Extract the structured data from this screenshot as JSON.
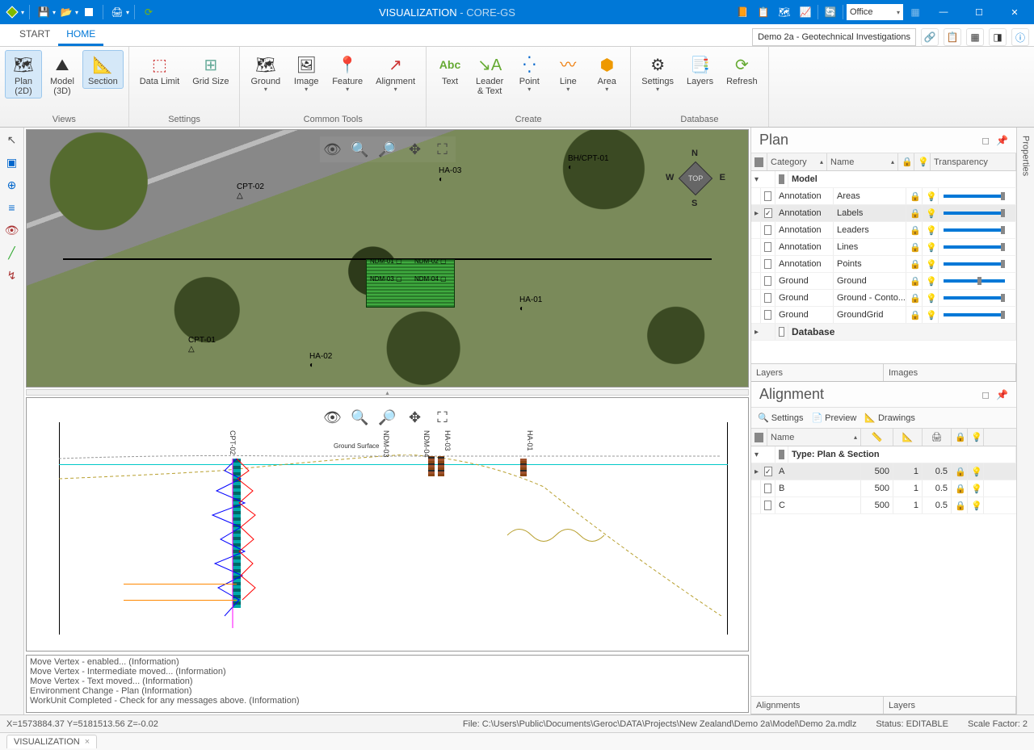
{
  "title": {
    "app": "VISUALIZATION",
    "suffix": " - CORE-GS"
  },
  "office": "Office",
  "tabs": {
    "start": "START",
    "home": "HOME"
  },
  "docselect": "Demo 2a - Geotechnical Investigations",
  "ribbon": {
    "groups": {
      "views": "Views",
      "settings": "Settings",
      "common": "Common Tools",
      "create": "Create",
      "database": "Database"
    },
    "btns": {
      "plan2d": "Plan\n(2D)",
      "model3d": "Model\n(3D)",
      "section": "Section",
      "datalimit": "Data Limit",
      "gridsize": "Grid Size",
      "ground": "Ground",
      "image": "Image",
      "feature": "Feature",
      "alignment": "Alignment",
      "text": "Text",
      "abc": "Abc",
      "leader": "Leader\n& Text",
      "point": "Point",
      "line": "Line",
      "area": "Area",
      "dbsettings": "Settings",
      "layers": "Layers",
      "refresh": "Refresh"
    }
  },
  "mapLabels": {
    "cpt01": "CPT-01",
    "cpt02": "CPT-02",
    "ha01": "HA-01",
    "ha02": "HA-02",
    "ha03": "HA-03",
    "bhcpt01": "BH/CPT-01",
    "ndm01": "NDM-01",
    "ndm02": "NDM-02",
    "ndm03": "NDM-03",
    "ndm04": "NDM-04"
  },
  "compass": {
    "n": "N",
    "e": "E",
    "s": "S",
    "w": "W",
    "top": "TOP"
  },
  "sectLabels": {
    "cpt02": "CPT-02",
    "ndm03": "NDM-03",
    "ndm04": "NDM-04",
    "ha03": "HA-03",
    "ha01": "HA-01",
    "gs": "Ground Surface"
  },
  "log": [
    "Move Vertex - enabled... (Information)",
    "Move Vertex - Intermediate moved... (Information)",
    "Move Vertex - Text moved... (Information)",
    "Environment Change - Plan (Information)",
    "WorkUnit Completed - Check for any messages above. (Information)"
  ],
  "planPanel": {
    "title": "Plan",
    "hdr": {
      "category": "Category",
      "name": "Name",
      "transp": "Transparency"
    },
    "groupModel": "Model",
    "rows": [
      {
        "cat": "Annotation",
        "name": "Areas",
        "bulb": true
      },
      {
        "cat": "Annotation",
        "name": "Labels",
        "bulb": true,
        "sel": true,
        "chk": true,
        "exp": true
      },
      {
        "cat": "Annotation",
        "name": "Leaders",
        "bulb": true
      },
      {
        "cat": "Annotation",
        "name": "Lines",
        "bulb": true
      },
      {
        "cat": "Annotation",
        "name": "Points",
        "bulb": true
      },
      {
        "cat": "Ground",
        "name": "Ground",
        "bulb": false,
        "slider": 0.6
      },
      {
        "cat": "Ground",
        "name": "Ground - Conto...",
        "bulb": false
      },
      {
        "cat": "Ground",
        "name": "GroundGrid",
        "bulb": false
      }
    ],
    "groupDb": "Database",
    "tabs": {
      "layers": "Layers",
      "images": "Images"
    }
  },
  "alignPanel": {
    "title": "Alignment",
    "toolbar": {
      "settings": "Settings",
      "preview": "Preview",
      "drawings": "Drawings"
    },
    "hdr": {
      "name": "Name"
    },
    "group": "Type: Plan & Section",
    "rows": [
      {
        "name": "A",
        "c1": "500",
        "c2": "1",
        "c3": "0.5",
        "chk": true,
        "sel": true,
        "bulb": true,
        "exp": true
      },
      {
        "name": "B",
        "c1": "500",
        "c2": "1",
        "c3": "0.5",
        "bulb": false
      },
      {
        "name": "C",
        "c1": "500",
        "c2": "1",
        "c3": "0.5",
        "bulb": false
      }
    ],
    "tabs": {
      "alignments": "Alignments",
      "layers": "Layers"
    }
  },
  "propsTab": "Properties",
  "status": {
    "coords": "X=1573884.37    Y=5181513.56    Z=-0.02",
    "file": "File: C:\\Users\\Public\\Documents\\Geroc\\DATA\\Projects\\New Zealand\\Demo 2a\\Model\\Demo 2a.mdlz",
    "editable": "Status: EDITABLE",
    "scale": "Scale Factor: 2"
  },
  "bottomTab": "VISUALIZATION"
}
